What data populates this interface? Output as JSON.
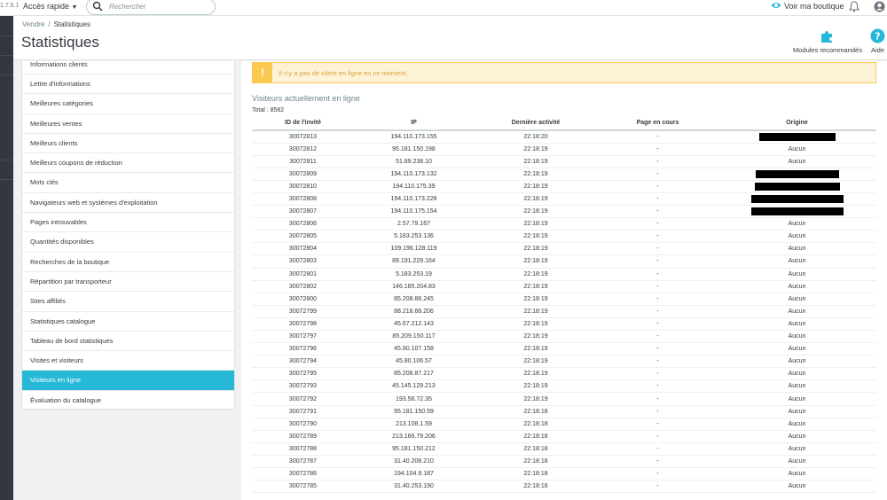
{
  "header": {
    "version": "1.7.5.1",
    "quick_access": "Accès rapide",
    "search_placeholder": "Rechercher",
    "shop_link": "Voir ma boutique"
  },
  "breadcrumb": {
    "parent": "Vendre",
    "separator": "/",
    "current": "Statistiques"
  },
  "page_title": "Statistiques",
  "toolbar": {
    "modules_label": "Modules recommandés",
    "help_label": "Aide"
  },
  "sidebar": {
    "items": [
      "Informations clients",
      "Lettre d'informations",
      "Meilleures catégories",
      "Meilleures ventes",
      "Meilleurs clients",
      "Meilleurs coupons de réduction",
      "Mots clés",
      "Navigateurs web et systèmes d'exploitation",
      "Pages introuvables",
      "Quantités disponibles",
      "Recherches de la boutique",
      "Répartition par transporteur",
      "Sites affiliés",
      "Statistiques catalogue",
      "Tableau de bord statistiques",
      "Visites et visiteurs",
      "Visiteurs en ligne",
      "Évaluation du catalogue"
    ],
    "active_index": 16
  },
  "main": {
    "alert": "Il n'y a pas de client en ligne en ce moment.",
    "section_title": "Visiteurs actuellement en ligne",
    "total": "Total : 8582",
    "columns": [
      "ID de l'invité",
      "IP",
      "Dernière activité",
      "Page en cours",
      "Origine"
    ],
    "rows": [
      [
        "30072813",
        "194.110.173.155",
        "22:18:20",
        "-",
        ""
      ],
      [
        "30072812",
        "95.181.150.198",
        "22:18:19",
        "-",
        "Aucun"
      ],
      [
        "30072811",
        "51.89.238.10",
        "22:18:19",
        "-",
        "Aucun"
      ],
      [
        "30072809",
        "194.110.173.132",
        "22:18:19",
        "-",
        ""
      ],
      [
        "30072810",
        "194.110.175.39",
        "22:18:19",
        "-",
        ""
      ],
      [
        "30072808",
        "194.110.173.228",
        "22:18:19",
        "-",
        ""
      ],
      [
        "30072807",
        "194.110.175.154",
        "22:18:19",
        "-",
        ""
      ],
      [
        "30072806",
        "2.57.79.167",
        "22:18:19",
        "-",
        "Aucun"
      ],
      [
        "30072805",
        "5.183.253.136",
        "22:18:19",
        "-",
        "Aucun"
      ],
      [
        "30072804",
        "109.196.128.119",
        "22:18:19",
        "-",
        "Aucun"
      ],
      [
        "30072803",
        "89.191.229.164",
        "22:18:19",
        "-",
        "Aucun"
      ],
      [
        "30072801",
        "5.183.253.19",
        "22:18:19",
        "-",
        "Aucun"
      ],
      [
        "30072802",
        "146.185.204.83",
        "22:18:19",
        "-",
        "Aucun"
      ],
      [
        "30072800",
        "85.208.86.245",
        "22:18:19",
        "-",
        "Aucun"
      ],
      [
        "30072799",
        "88.218.66.206",
        "22:18:19",
        "-",
        "Aucun"
      ],
      [
        "30072798",
        "45.67.212.143",
        "22:18:19",
        "-",
        "Aucun"
      ],
      [
        "30072797",
        "85.209.150.117",
        "22:18:19",
        "-",
        "Aucun"
      ],
      [
        "30072796",
        "45.80.107.158",
        "22:18:19",
        "-",
        "Aucun"
      ],
      [
        "30072794",
        "45.80.106.57",
        "22:18:19",
        "-",
        "Aucun"
      ],
      [
        "30072795",
        "85.208.87.217",
        "22:18:19",
        "-",
        "Aucun"
      ],
      [
        "30072793",
        "45.145.129.213",
        "22:18:19",
        "-",
        "Aucun"
      ],
      [
        "30072792",
        "193.56.72.35",
        "22:18:19",
        "-",
        "Aucun"
      ],
      [
        "30072791",
        "95.181.150.59",
        "22:18:18",
        "-",
        "Aucun"
      ],
      [
        "30072790",
        "213.108.1.59",
        "22:18:18",
        "-",
        "Aucun"
      ],
      [
        "30072789",
        "213.166.79.206",
        "22:18:18",
        "-",
        "Aucun"
      ],
      [
        "30072788",
        "95.181.150.212",
        "22:18:18",
        "-",
        "Aucun"
      ],
      [
        "30072787",
        "31.40.208.210",
        "22:18:18",
        "-",
        "Aucun"
      ],
      [
        "30072786",
        "194.104.9.187",
        "22:18:18",
        "-",
        "Aucun"
      ],
      [
        "30072785",
        "31.40.253.190",
        "22:18:18",
        "-",
        "Aucun"
      ]
    ]
  },
  "colors": {
    "accent": "#25b9d7",
    "warning_border": "#fcc94f",
    "warning_bg": "#fff3d7",
    "sidebar_dark": "#31383f"
  }
}
